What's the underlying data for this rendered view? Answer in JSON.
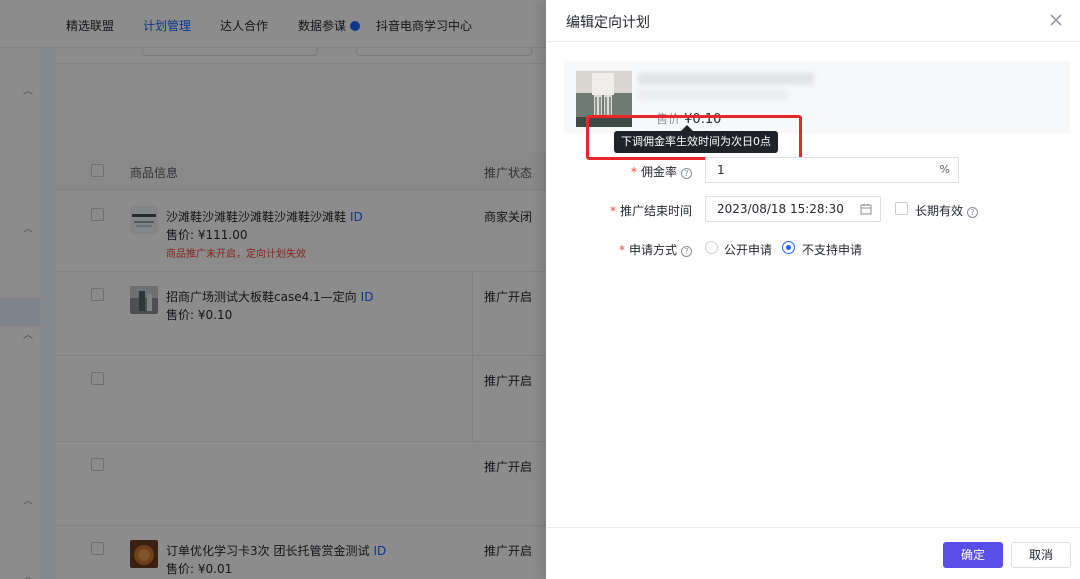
{
  "nav": {
    "items": [
      {
        "label": "精选联盟",
        "active": false
      },
      {
        "label": "计划管理",
        "active": true
      },
      {
        "label": "达人合作",
        "active": false
      },
      {
        "label": "数据参谋",
        "active": false
      },
      {
        "label": "抖音电商学习中心",
        "active": false
      }
    ]
  },
  "table": {
    "columns": [
      "商品信息",
      "推广状态"
    ],
    "rows": [
      {
        "name": "沙滩鞋沙滩鞋沙滩鞋沙滩鞋沙滩鞋",
        "id_tag": "ID",
        "price": "售价: ¥111.00",
        "warning": "商品推广未开启，定向计划失效",
        "status": "商家关闭"
      },
      {
        "name": "招商广场测试大板鞋case4.1—定向",
        "id_tag": "ID",
        "price": "售价: ¥0.10",
        "warning": "",
        "status": "推广开启"
      },
      {
        "name": "",
        "id_tag": "",
        "price": "",
        "warning": "",
        "status": "推广开启"
      },
      {
        "name": "",
        "id_tag": "",
        "price": "",
        "warning": "",
        "status": "推广开启"
      },
      {
        "name": "订单优化学习卡3次 团长托管赏金测试",
        "id_tag": "ID",
        "price": "售价: ¥0.01",
        "warning": "",
        "status": "推广开启"
      }
    ]
  },
  "drawer": {
    "title": "编辑定向计划",
    "product": {
      "price_label": "售价",
      "price_value": "¥0.10"
    },
    "tooltip": "下调佣金率生效时间为次日0点",
    "form": {
      "commission": {
        "label": "佣金率",
        "value": "1",
        "suffix": "%"
      },
      "end_time": {
        "label": "推广结束时间",
        "value": "2023/08/18 15:28:30",
        "long_term_label": "长期有效",
        "long_term_checked": false
      },
      "apply_mode": {
        "label": "申请方式",
        "options": [
          {
            "label": "公开申请",
            "selected": false
          },
          {
            "label": "不支持申请",
            "selected": true
          }
        ]
      }
    },
    "buttons": {
      "confirm": "确定",
      "cancel": "取消"
    }
  },
  "colors": {
    "accent": "#1966ff",
    "primary_button": "#5a4ee8",
    "highlight": "#e8262c",
    "required": "#f5473d"
  }
}
